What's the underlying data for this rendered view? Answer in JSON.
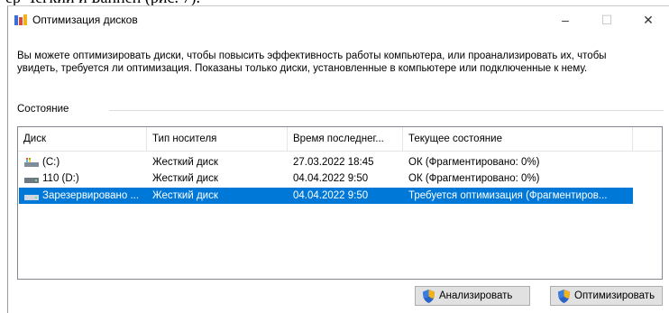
{
  "window": {
    "title": "Оптимизация дисков",
    "controls": {
      "minimize": "–",
      "maximize": "☐",
      "close": "✕"
    }
  },
  "description": "Вы можете оптимизировать диски, чтобы повысить эффективность работы  компьютера, или проанализировать их, чтобы увидеть, требуется ли оптимизация. Показаны только диски, установленные в компьютере или подключенные к нему.",
  "status_section": "Состояние",
  "table": {
    "columns": [
      "Диск",
      "Тип носителя",
      "Время последнег...",
      "Текущее состояние"
    ],
    "rows": [
      {
        "disk": "(C:)",
        "media": "Жесткий диск",
        "time": "27.03.2022 18:45",
        "status": "ОК (Фрагментировано: 0%)",
        "icon": "system-drive-icon",
        "selected": false
      },
      {
        "disk": "110 (D:)",
        "media": "Жесткий диск",
        "time": "04.04.2022 9:50",
        "status": "ОК (Фрагментировано: 0%)",
        "icon": "drive-icon",
        "selected": false
      },
      {
        "disk": "Зарезервировано ...",
        "media": "Жесткий диск",
        "time": "04.04.2022 9:50",
        "status": "Требуется оптимизация (Фрагментиров...",
        "icon": "drive-icon",
        "selected": true
      }
    ]
  },
  "buttons": {
    "analyze": "Анализировать",
    "optimize": "Оптимизировать"
  },
  "icons": [
    "defrag-app-icon",
    "shield-icon",
    "drive-icon",
    "system-drive-icon"
  ],
  "colors": {
    "selection": "#0078d7",
    "button_bg": "#e1e1e1",
    "border": "#828790"
  }
}
